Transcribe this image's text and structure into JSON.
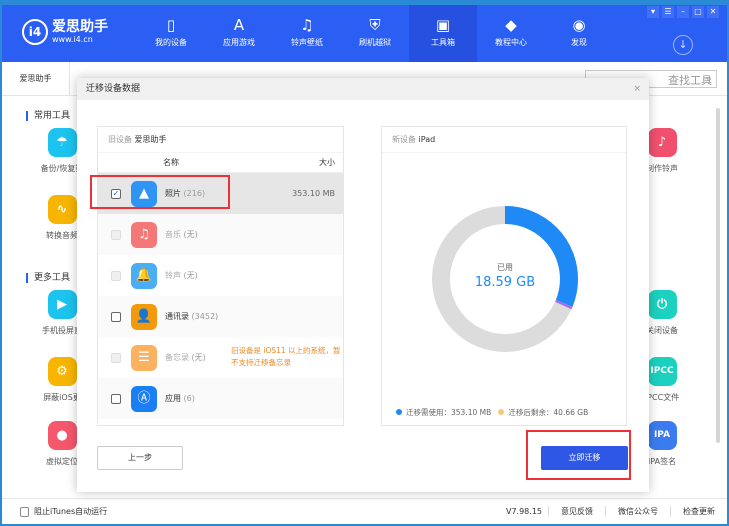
{
  "app": {
    "logo_main": "爱思助手",
    "logo_url": "www.i4.cn",
    "logo_mark": "i4"
  },
  "nav": [
    {
      "label": "我的设备",
      "icon": "phone-icon",
      "glyph": "▯"
    },
    {
      "label": "应用游戏",
      "icon": "app-store-icon",
      "glyph": "A"
    },
    {
      "label": "铃声壁纸",
      "icon": "music-icon",
      "glyph": "♫"
    },
    {
      "label": "刷机越狱",
      "icon": "shield-key-icon",
      "glyph": "⛨"
    },
    {
      "label": "工具箱",
      "icon": "toolbox-icon",
      "glyph": "▣"
    },
    {
      "label": "教程中心",
      "icon": "graduation-cap-icon",
      "glyph": "◆"
    },
    {
      "label": "发现",
      "icon": "compass-icon",
      "glyph": "◉"
    }
  ],
  "window_buttons": [
    "▾",
    "☰",
    "–",
    "▢",
    "✕"
  ],
  "tab": "爱思助手",
  "search_placeholder": "查找工具",
  "sections": [
    "常用工具",
    "更多工具"
  ],
  "tools_left": [
    {
      "label": "备份/恢复数",
      "color": "#1cc3ee",
      "glyph": "☂"
    },
    {
      "label": "转换音频",
      "color": "#f7b500",
      "glyph": "∿"
    },
    {
      "label": "手机投屏直",
      "color": "#1cc3ee",
      "glyph": "▶"
    },
    {
      "label": "屏蔽iOS更",
      "color": "#f7b500",
      "glyph": "⚙"
    },
    {
      "label": "虚拟定位",
      "color": "#f5576c",
      "glyph": "●"
    }
  ],
  "tools_right": [
    {
      "label": "制作铃声",
      "color": "#f0506e",
      "glyph": "♪"
    },
    {
      "label": "关闭设备",
      "color": "#1cd1bf",
      "glyph": "⏻"
    },
    {
      "label": "IPCC文件",
      "color": "#1cd1bf",
      "glyph": "IPCC"
    },
    {
      "label": "IPA签名",
      "color": "#3a7cf0",
      "glyph": "IPA"
    }
  ],
  "dialog": {
    "title": "迁移设备数据",
    "close": "×",
    "old_label": "旧设备",
    "old_name": "爱思助手",
    "col_name": "名称",
    "col_size": "大小",
    "items": [
      {
        "name": "照片",
        "count": "(216)",
        "size": "353.10 MB",
        "checked": true,
        "disabled": false,
        "color": "#2f95f5",
        "glyph": "▲"
      },
      {
        "name": "音乐",
        "count": "(无)",
        "size": "",
        "checked": false,
        "disabled": true,
        "color": "#f57878",
        "glyph": "♫"
      },
      {
        "name": "铃声",
        "count": "(无)",
        "size": "",
        "checked": false,
        "disabled": true,
        "color": "#49aef5",
        "glyph": "🔔"
      },
      {
        "name": "通讯录",
        "count": "(3452)",
        "size": "",
        "checked": false,
        "disabled": false,
        "color": "#f29a0c",
        "glyph": "👤"
      },
      {
        "name": "备忘录",
        "count": "(无)",
        "size": "",
        "checked": false,
        "disabled": true,
        "color": "#fbb260",
        "glyph": "☰"
      },
      {
        "name": "应用",
        "count": "(6)",
        "size": "",
        "checked": false,
        "disabled": false,
        "color": "#1a7ef5",
        "glyph": "Ⓐ"
      }
    ],
    "notes_warning": "旧设备是 iOS11 以上的系统，暂不支持迁移备忘录",
    "new_label": "新设备",
    "new_name": "iPad",
    "used_label": "已用",
    "used_value": "18.59 GB",
    "legend_need_label": "迁移需使用：",
    "legend_need_value": "353.10 MB",
    "legend_remain_label": "迁移后剩余：",
    "legend_remain_value": "40.66 GB",
    "prev_button": "上一步",
    "migrate_button": "立即迁移"
  },
  "storage": {
    "used_gb": 18.59,
    "migrate_gb": 0.345,
    "remaining_gb": 40.66,
    "colors": {
      "used": "#1f8af5",
      "migrate": "#a86cf0",
      "free": "#dcdcdc"
    }
  },
  "footer": {
    "checkbox_label": "阻止iTunes自动运行",
    "version": "V7.98.15",
    "links": [
      "意见反馈",
      "微信公众号",
      "检查更新"
    ]
  }
}
